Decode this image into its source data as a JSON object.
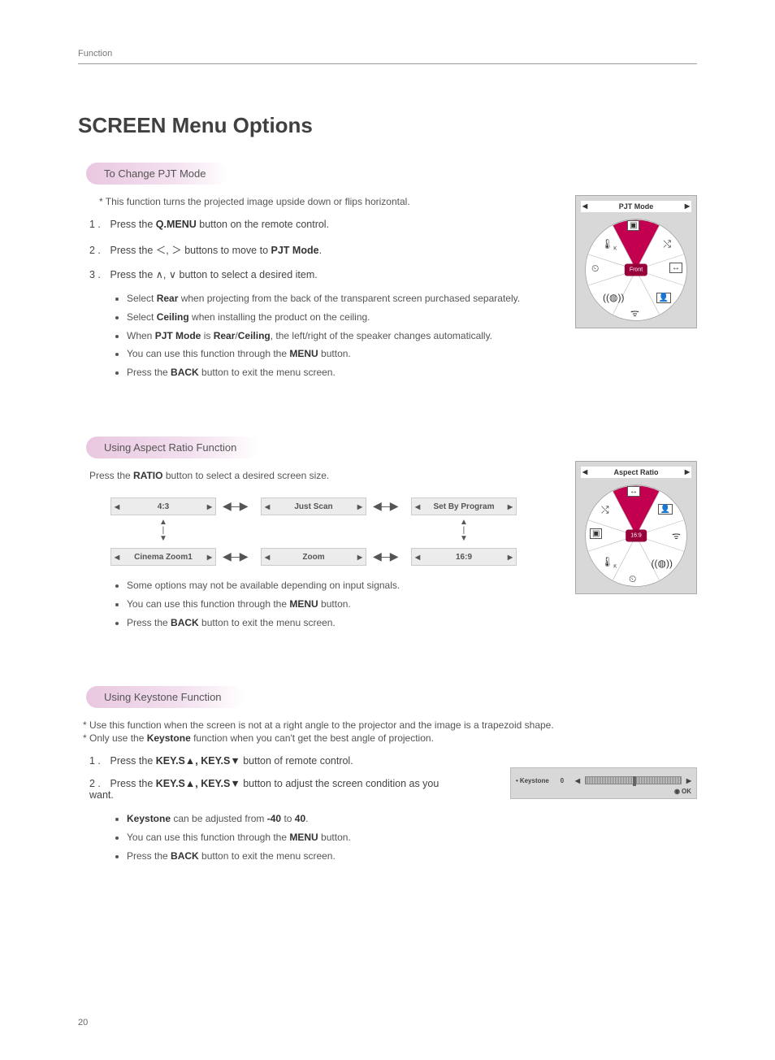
{
  "header": {
    "section": "Function"
  },
  "title": "SCREEN Menu Options",
  "page_number": "20",
  "pjt": {
    "heading": "To Change PJT Mode",
    "intro": "* This function turns the projected image upside down or flips horizontal.",
    "steps": {
      "s1_a": "Press the ",
      "s1_b": "Q.MENU",
      "s1_c": " button on the remote control.",
      "s2_a": "Press the ",
      "s2_b": "＜, ＞",
      "s2_c": " buttons to move to ",
      "s2_d": "PJT Mode",
      "s2_e": ".",
      "s3_a": "Press the ",
      "s3_b": "∧, ∨",
      "s3_c": " button to select a desired item."
    },
    "bullets": {
      "b1_a": "Select ",
      "b1_b": "Rear",
      "b1_c": " when projecting from the back of the transparent screen purchased separately.",
      "b2_a": "Select ",
      "b2_b": "Ceiling",
      "b2_c": " when installing the product on the ceiling.",
      "b3_a": "When ",
      "b3_b": "PJT Mode",
      "b3_c": " is ",
      "b3_d": "Rear",
      "b3_e": "/",
      "b3_f": "Ceiling",
      "b3_g": ", the left/right of the speaker changes automatically.",
      "b4_a": "You can use this function through the ",
      "b4_b": "MENU",
      "b4_c": " button.",
      "b5_a": "Press the ",
      "b5_b": "BACK",
      "b5_c": " button to exit the menu screen."
    },
    "osd": {
      "title": "PJT Mode",
      "center": "Front"
    }
  },
  "aspect": {
    "heading": "Using Aspect Ratio Function",
    "intro_a": "Press the ",
    "intro_b": "RATIO",
    "intro_c": " button to select a desired screen size.",
    "options": {
      "o1": "4:3",
      "o2": "Just Scan",
      "o3": "Set By Program",
      "o4": "Cinema Zoom1",
      "o5": "Zoom",
      "o6": "16:9"
    },
    "bullets": {
      "b1": "Some options may not be available depending on input signals.",
      "b2_a": "You can use this function through the ",
      "b2_b": "MENU",
      "b2_c": " button.",
      "b3_a": "Press the ",
      "b3_b": "BACK",
      "b3_c": " button to exit the menu screen."
    },
    "osd": {
      "title": "Aspect Ratio",
      "center": "16:9"
    }
  },
  "keystone": {
    "heading": "Using Keystone Function",
    "intro1": "* Use this function when the screen is not at a right angle to the projector and the image is a trapezoid shape.",
    "intro2_a": "* Only use the ",
    "intro2_b": "Keystone",
    "intro2_c": " function when you can't get the best angle of projection.",
    "steps": {
      "s1_a": "Press the ",
      "s1_b": "KEY.S▲, KEY.S▼",
      "s1_c": " button of remote control.",
      "s2_a": "Press the ",
      "s2_b": "KEY.S▲, KEY.S▼",
      "s2_c": " button to adjust the screen condition as you want."
    },
    "bullets": {
      "b1_a": "Keystone",
      "b1_b": " can be adjusted from ",
      "b1_c": "-40",
      "b1_d": " to ",
      "b1_e": "40",
      "b1_f": ".",
      "b2_a": "You can use this function through the ",
      "b2_b": "MENU",
      "b2_c": " button.",
      "b3_a": "Press the ",
      "b3_b": "BACK",
      "b3_c": " button to exit the menu screen."
    },
    "osd": {
      "label": "Keystone",
      "value": "0",
      "ok": "OK"
    }
  }
}
